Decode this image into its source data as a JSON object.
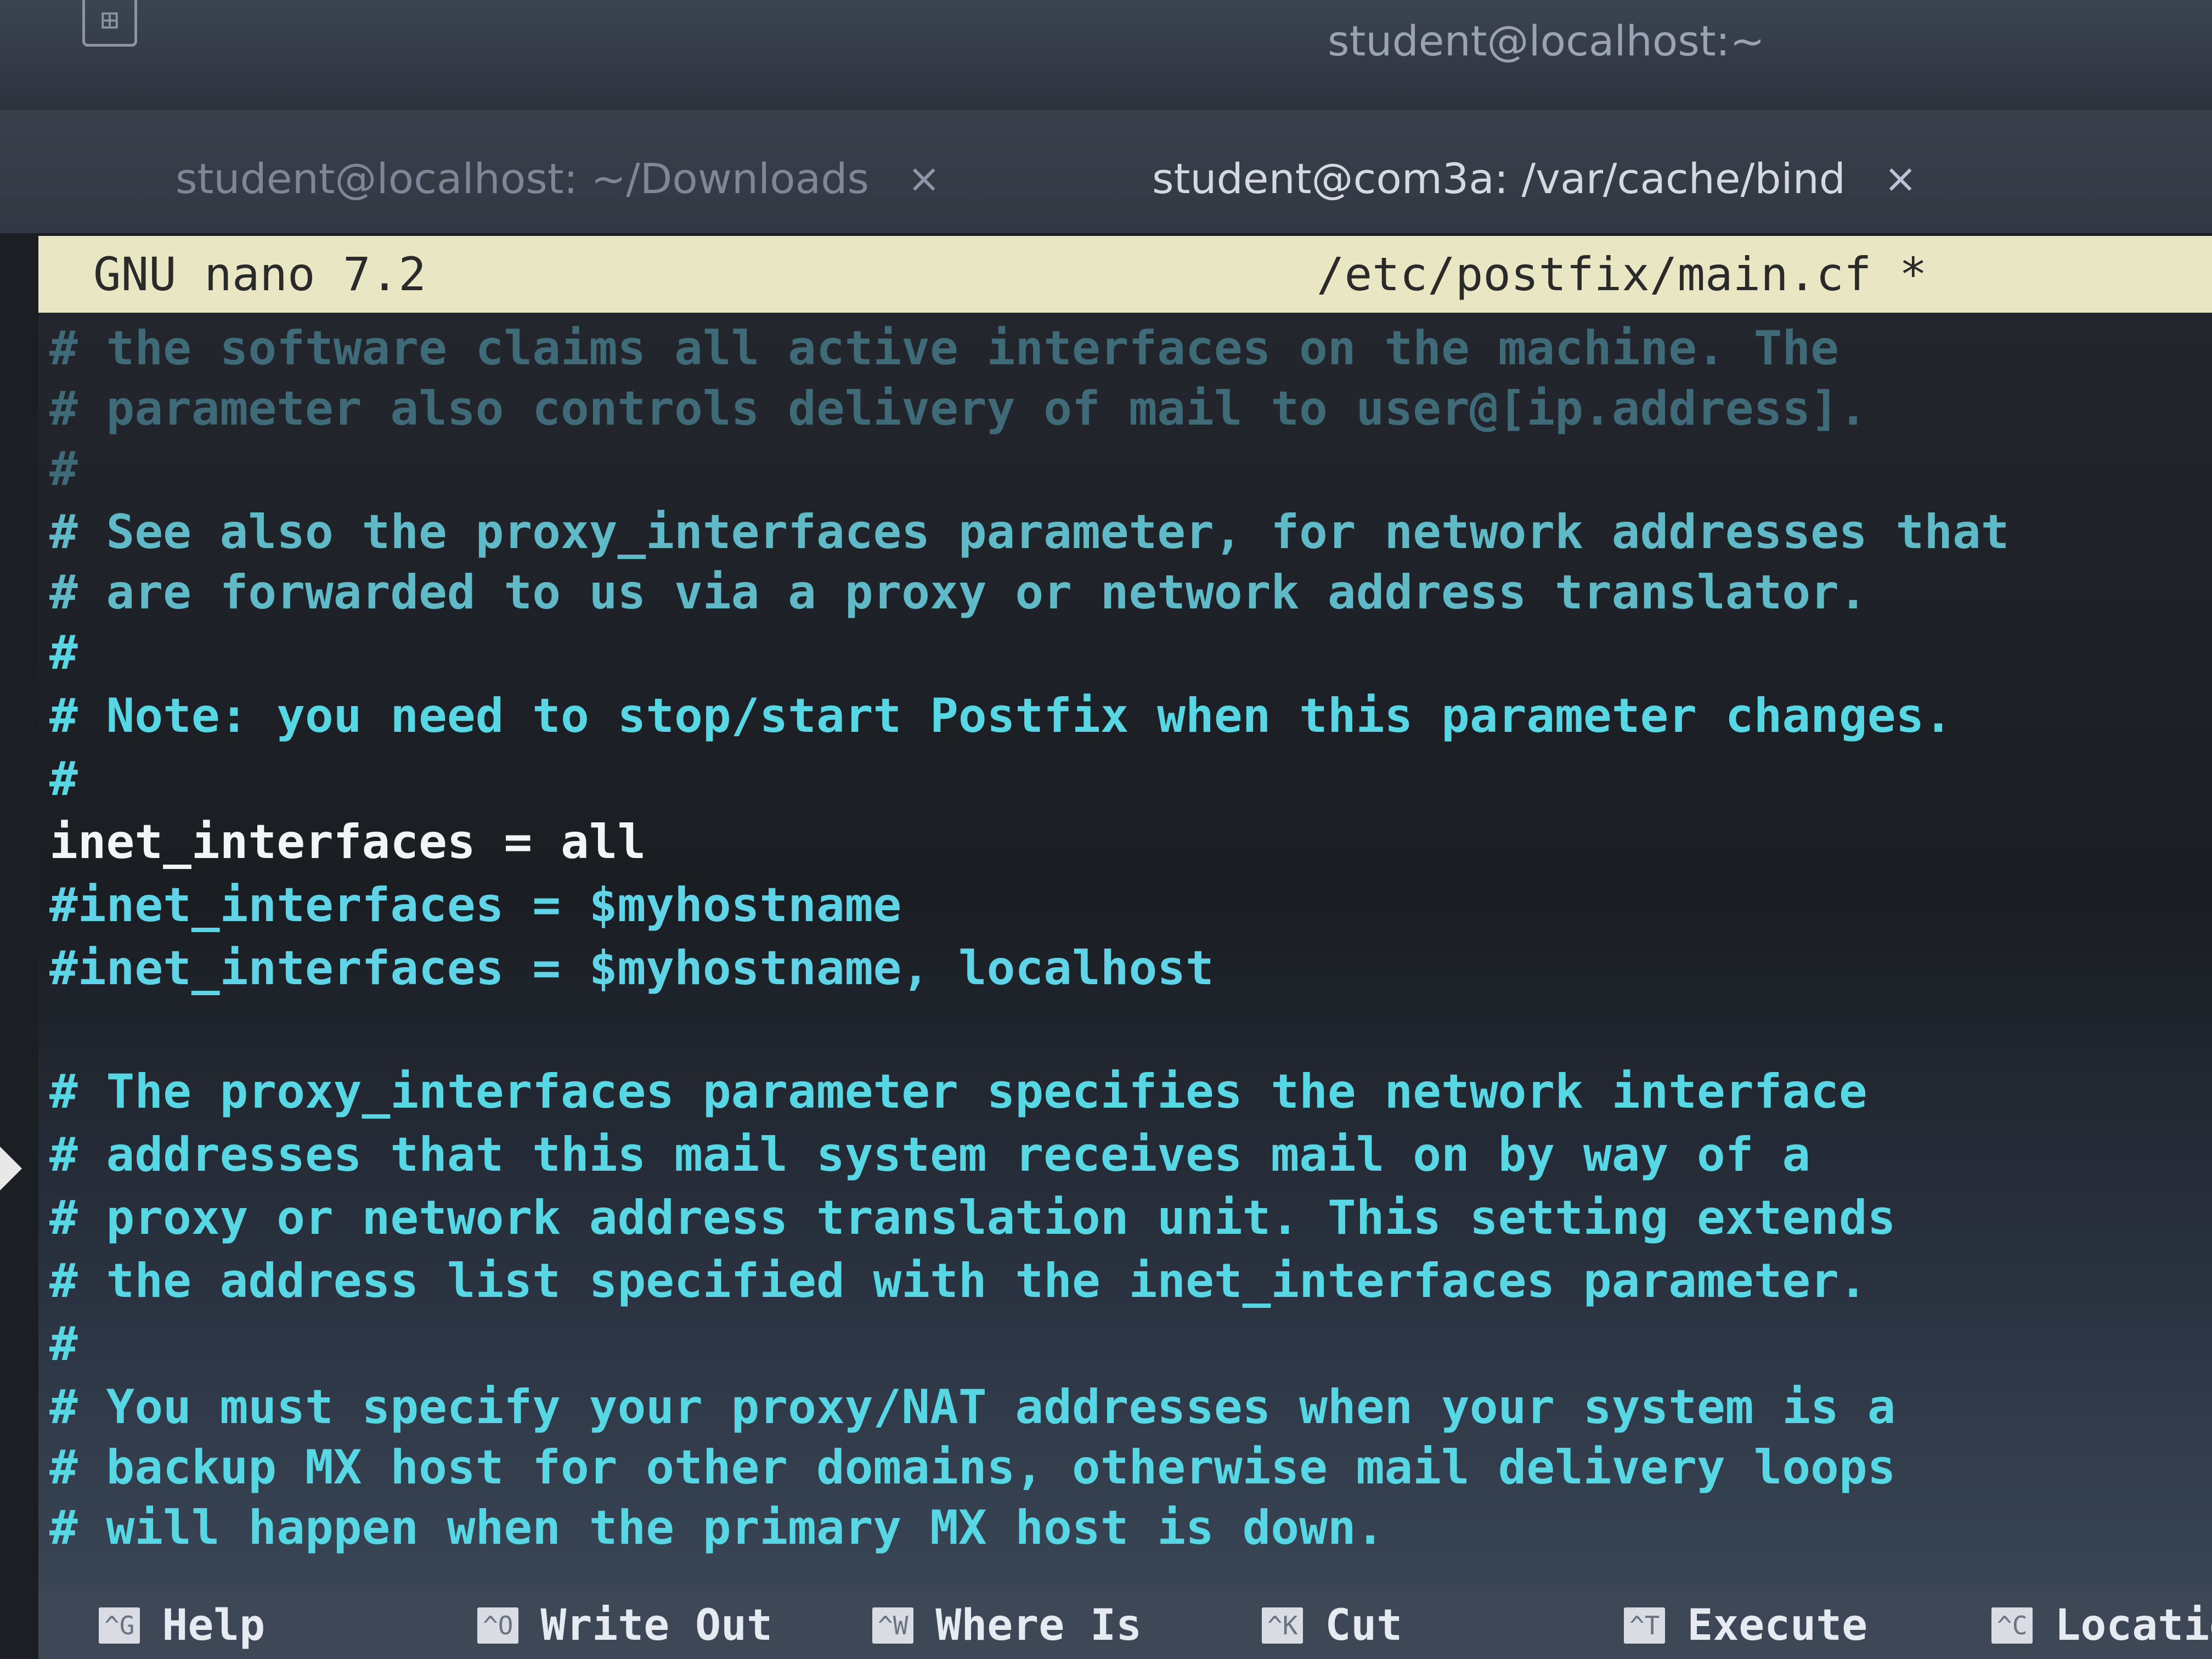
{
  "window": {
    "title": "student@localhost:~"
  },
  "tabs": [
    {
      "label": "student@localhost: ~/Downloads",
      "close": "×"
    },
    {
      "label": "student@com3a: /var/cache/bind",
      "close": "×"
    }
  ],
  "nano": {
    "version": "GNU nano 7.2",
    "filename": "/etc/postfix/main.cf *"
  },
  "lines": [
    "# the software claims all active interfaces on the machine. The",
    "# parameter also controls delivery of mail to user@[ip.address].",
    "#",
    "# See also the proxy_interfaces parameter, for network addresses that",
    "# are forwarded to us via a proxy or network address translator.",
    "#",
    "# Note: you need to stop/start Postfix when this parameter changes.",
    "#",
    "inet_interfaces = all",
    "#inet_interfaces = $myhostname",
    "#inet_interfaces = $myhostname, localhost",
    "",
    "# The proxy_interfaces parameter specifies the network interface",
    "# addresses that this mail system receives mail on by way of a",
    "# proxy or network address translation unit. This setting extends",
    "# the address list specified with the inet_interfaces parameter.",
    "#",
    "# You must specify your proxy/NAT addresses when your system is a",
    "# backup MX host for other domains, otherwise mail delivery loops",
    "# will happen when the primary MX host is down."
  ],
  "shortcuts": [
    {
      "key": "^G",
      "label": "Help"
    },
    {
      "key": "^O",
      "label": "Write Out"
    },
    {
      "key": "^W",
      "label": "Where Is"
    },
    {
      "key": "^K",
      "label": "Cut"
    },
    {
      "key": "^T",
      "label": "Execute"
    },
    {
      "key": "^C",
      "label": "Locatio"
    }
  ],
  "colors": {
    "header_bg": "#e9e6c3",
    "comment": "#57d6e3",
    "code": "#f2f4f6"
  }
}
